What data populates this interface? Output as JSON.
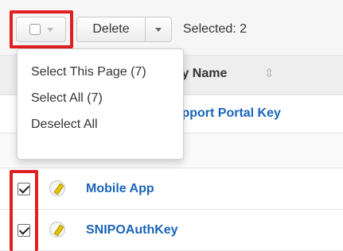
{
  "toolbar": {
    "delete_label": "Delete",
    "selected_text": "Selected: 2"
  },
  "menu": {
    "items": [
      {
        "label": "Select This Page (7)"
      },
      {
        "label": "Select All (7)"
      },
      {
        "label": "Deselect All"
      }
    ]
  },
  "table": {
    "column_header": "Key Name",
    "sort_icon": "⇳",
    "rows": [
      {
        "name": "Support Portal Key",
        "checked": false
      },
      {
        "name": "",
        "checked": false
      },
      {
        "name": "Mobile App",
        "checked": true
      },
      {
        "name": "SNIPOAuthKey",
        "checked": true
      }
    ]
  },
  "colors": {
    "highlight": "#e02020",
    "link": "#1a64b8"
  },
  "icons": {
    "edit": "pencil-icon",
    "sort": "sort-icon",
    "caret": "chevron-down-icon"
  }
}
